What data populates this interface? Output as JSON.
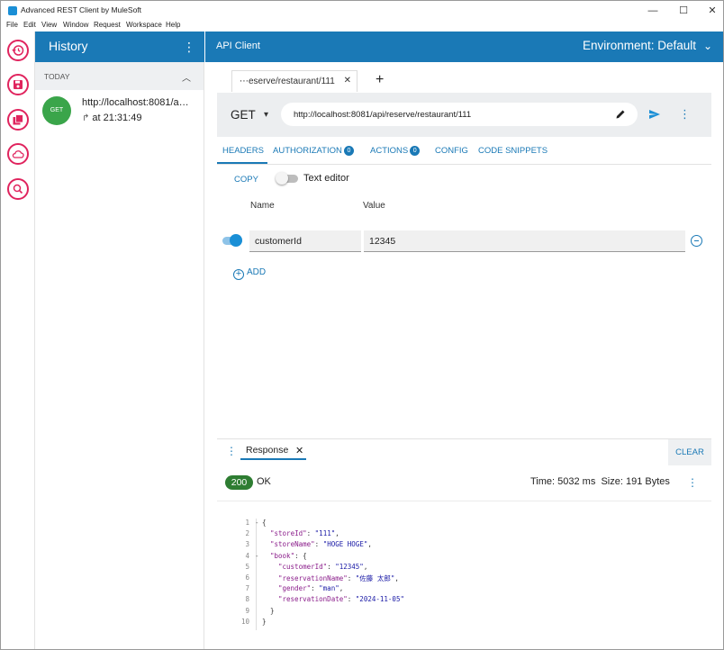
{
  "window": {
    "title": "Advanced REST Client by MuleSoft",
    "menu": [
      "File",
      "Edit",
      "View",
      "Window",
      "Request",
      "Workspace",
      "Help"
    ],
    "controls": [
      "—",
      "☐",
      "✕"
    ]
  },
  "rail": {
    "items": [
      "history-icon",
      "save-icon",
      "saved-requests-icon",
      "cloud-icon",
      "search-icon"
    ],
    "accent": "#e0245e"
  },
  "history": {
    "title": "History",
    "group": "TODAY",
    "items": [
      {
        "method": "GET",
        "url": "http://localhost:8081/a…",
        "time": "at 21:31:49"
      }
    ]
  },
  "main": {
    "title": "API Client",
    "environment": "Environment: Default"
  },
  "request": {
    "tab_label": "⋯eserve/restaurant/111",
    "method": "GET",
    "url": "http://localhost:8081/api/reserve/restaurant/111"
  },
  "config_tabs": {
    "headers": "HEADERS",
    "authorization": "AUTHORIZATION",
    "authorization_count": "0",
    "actions": "ACTIONS",
    "actions_count": "0",
    "config": "CONFIG",
    "code_snippets": "CODE SNIPPETS"
  },
  "headers_editor": {
    "copy": "COPY",
    "text_editor": "Text editor",
    "col_name": "Name",
    "col_value": "Value",
    "rows": [
      {
        "name": "customerId",
        "value": "12345"
      }
    ],
    "add": "ADD"
  },
  "response": {
    "tab": "Response",
    "clear": "CLEAR",
    "status_code": "200",
    "status_text": "OK",
    "time": "Time: 5032 ms",
    "size": "Size: 191 Bytes",
    "body_lines": [
      {
        "n": "1",
        "fold": "-",
        "indent": 0,
        "parts": [
          [
            "p",
            "{"
          ]
        ]
      },
      {
        "n": "2",
        "fold": "",
        "indent": 1,
        "parts": [
          [
            "k",
            "\"storeId\""
          ],
          [
            "p",
            ": "
          ],
          [
            "s",
            "\"111\""
          ],
          [
            "p",
            ","
          ]
        ]
      },
      {
        "n": "3",
        "fold": "",
        "indent": 1,
        "parts": [
          [
            "k",
            "\"storeName\""
          ],
          [
            "p",
            ": "
          ],
          [
            "s",
            "\"HOGE HOGE\""
          ],
          [
            "p",
            ","
          ]
        ]
      },
      {
        "n": "4",
        "fold": "-",
        "indent": 1,
        "parts": [
          [
            "k",
            "\"book\""
          ],
          [
            "p",
            ": {"
          ]
        ]
      },
      {
        "n": "5",
        "fold": "",
        "indent": 2,
        "parts": [
          [
            "k",
            "\"customerId\""
          ],
          [
            "p",
            ": "
          ],
          [
            "s",
            "\"12345\""
          ],
          [
            "p",
            ","
          ]
        ]
      },
      {
        "n": "6",
        "fold": "",
        "indent": 2,
        "parts": [
          [
            "k",
            "\"reservationName\""
          ],
          [
            "p",
            ": "
          ],
          [
            "s",
            "\"佐藤 太郎\""
          ],
          [
            "p",
            ","
          ]
        ]
      },
      {
        "n": "7",
        "fold": "",
        "indent": 2,
        "parts": [
          [
            "k",
            "\"gender\""
          ],
          [
            "p",
            ": "
          ],
          [
            "s",
            "\"man\""
          ],
          [
            "p",
            ","
          ]
        ]
      },
      {
        "n": "8",
        "fold": "",
        "indent": 2,
        "parts": [
          [
            "k",
            "\"reservationDate\""
          ],
          [
            "p",
            ": "
          ],
          [
            "s",
            "\"2024-11-05\""
          ]
        ]
      },
      {
        "n": "9",
        "fold": "",
        "indent": 1,
        "parts": [
          [
            "p",
            "}"
          ]
        ]
      },
      {
        "n": "10",
        "fold": "",
        "indent": 0,
        "parts": [
          [
            "p",
            "}"
          ]
        ]
      }
    ]
  },
  "colors": {
    "brand": "#1a79b6",
    "success": "#2e7d32",
    "get_badge": "#3aa54a"
  }
}
